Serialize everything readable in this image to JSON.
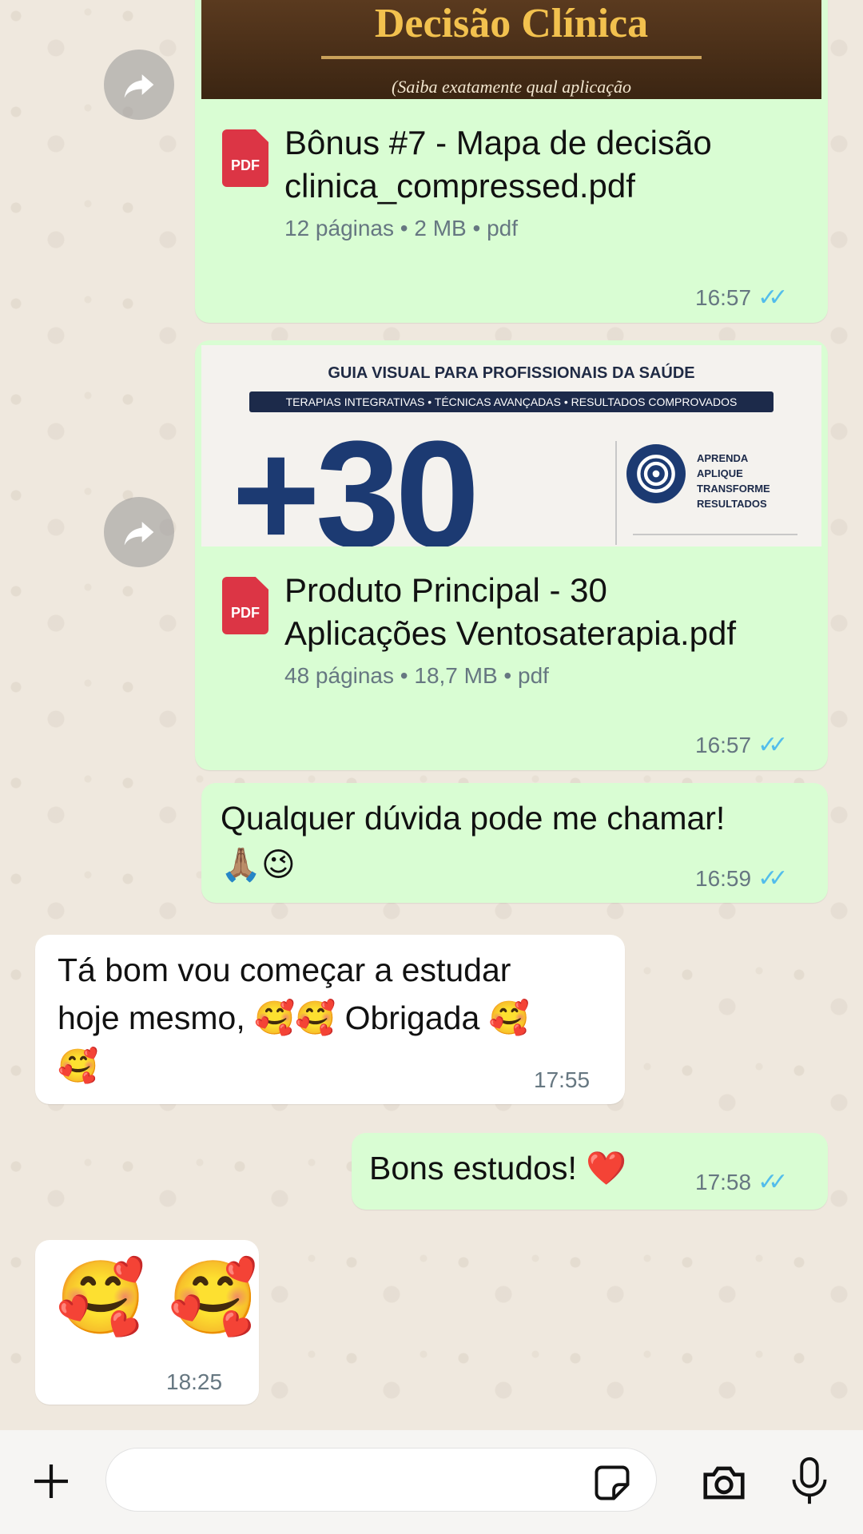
{
  "messages": {
    "doc1": {
      "thumb_title": "Decisão Clínica",
      "thumb_subtitle": "(Saiba exatamente qual aplicação",
      "name_line1": "Bônus #7 - Mapa de decisão",
      "name_line2": "clinica_compressed.pdf",
      "meta": "12 páginas • 2 MB • pdf",
      "time": "16:57",
      "icon_label": "PDF"
    },
    "doc2": {
      "thumb_header": "GUIA VISUAL PARA PROFISSIONAIS DA SAÚDE",
      "thumb_band": "TERAPIAS INTEGRATIVAS • TÉCNICAS AVANÇADAS • RESULTADOS COMPROVADOS",
      "thumb_big": "+30",
      "thumb_side": [
        "APRENDA",
        "APLIQUE",
        "TRANSFORME",
        "RESULTADOS"
      ],
      "name_line1": "Produto Principal - 30",
      "name_line2": "Aplicações Ventosaterapia.pdf",
      "meta": "48 páginas • 18,7 MB • pdf",
      "time": "16:57",
      "icon_label": "PDF"
    },
    "out1": {
      "line1": "Qualquer dúvida pode me chamar!",
      "line2": "🙏🏽😉",
      "time": "16:59"
    },
    "in1": {
      "line1": "Tá bom vou começar a estudar",
      "line2": "hoje mesmo, 🥰🥰 Obrigada 🥰",
      "line3": "🥰",
      "time": "17:55"
    },
    "out2": {
      "text": "Bons estudos! ❤️",
      "time": "17:58"
    },
    "in2": {
      "text": "🥰 🥰",
      "time": "18:25"
    }
  },
  "icons": {
    "forward": "forward-icon",
    "read_ticks": "double-check-icon",
    "plus": "plus-icon",
    "sticker": "sticker-icon",
    "camera": "camera-icon",
    "mic": "microphone-icon"
  },
  "colors": {
    "outgoing_bubble": "#d9fdd3",
    "incoming_bubble": "#ffffff",
    "read_ticks": "#53bdeb",
    "pdf_icon": "#dc3545"
  }
}
